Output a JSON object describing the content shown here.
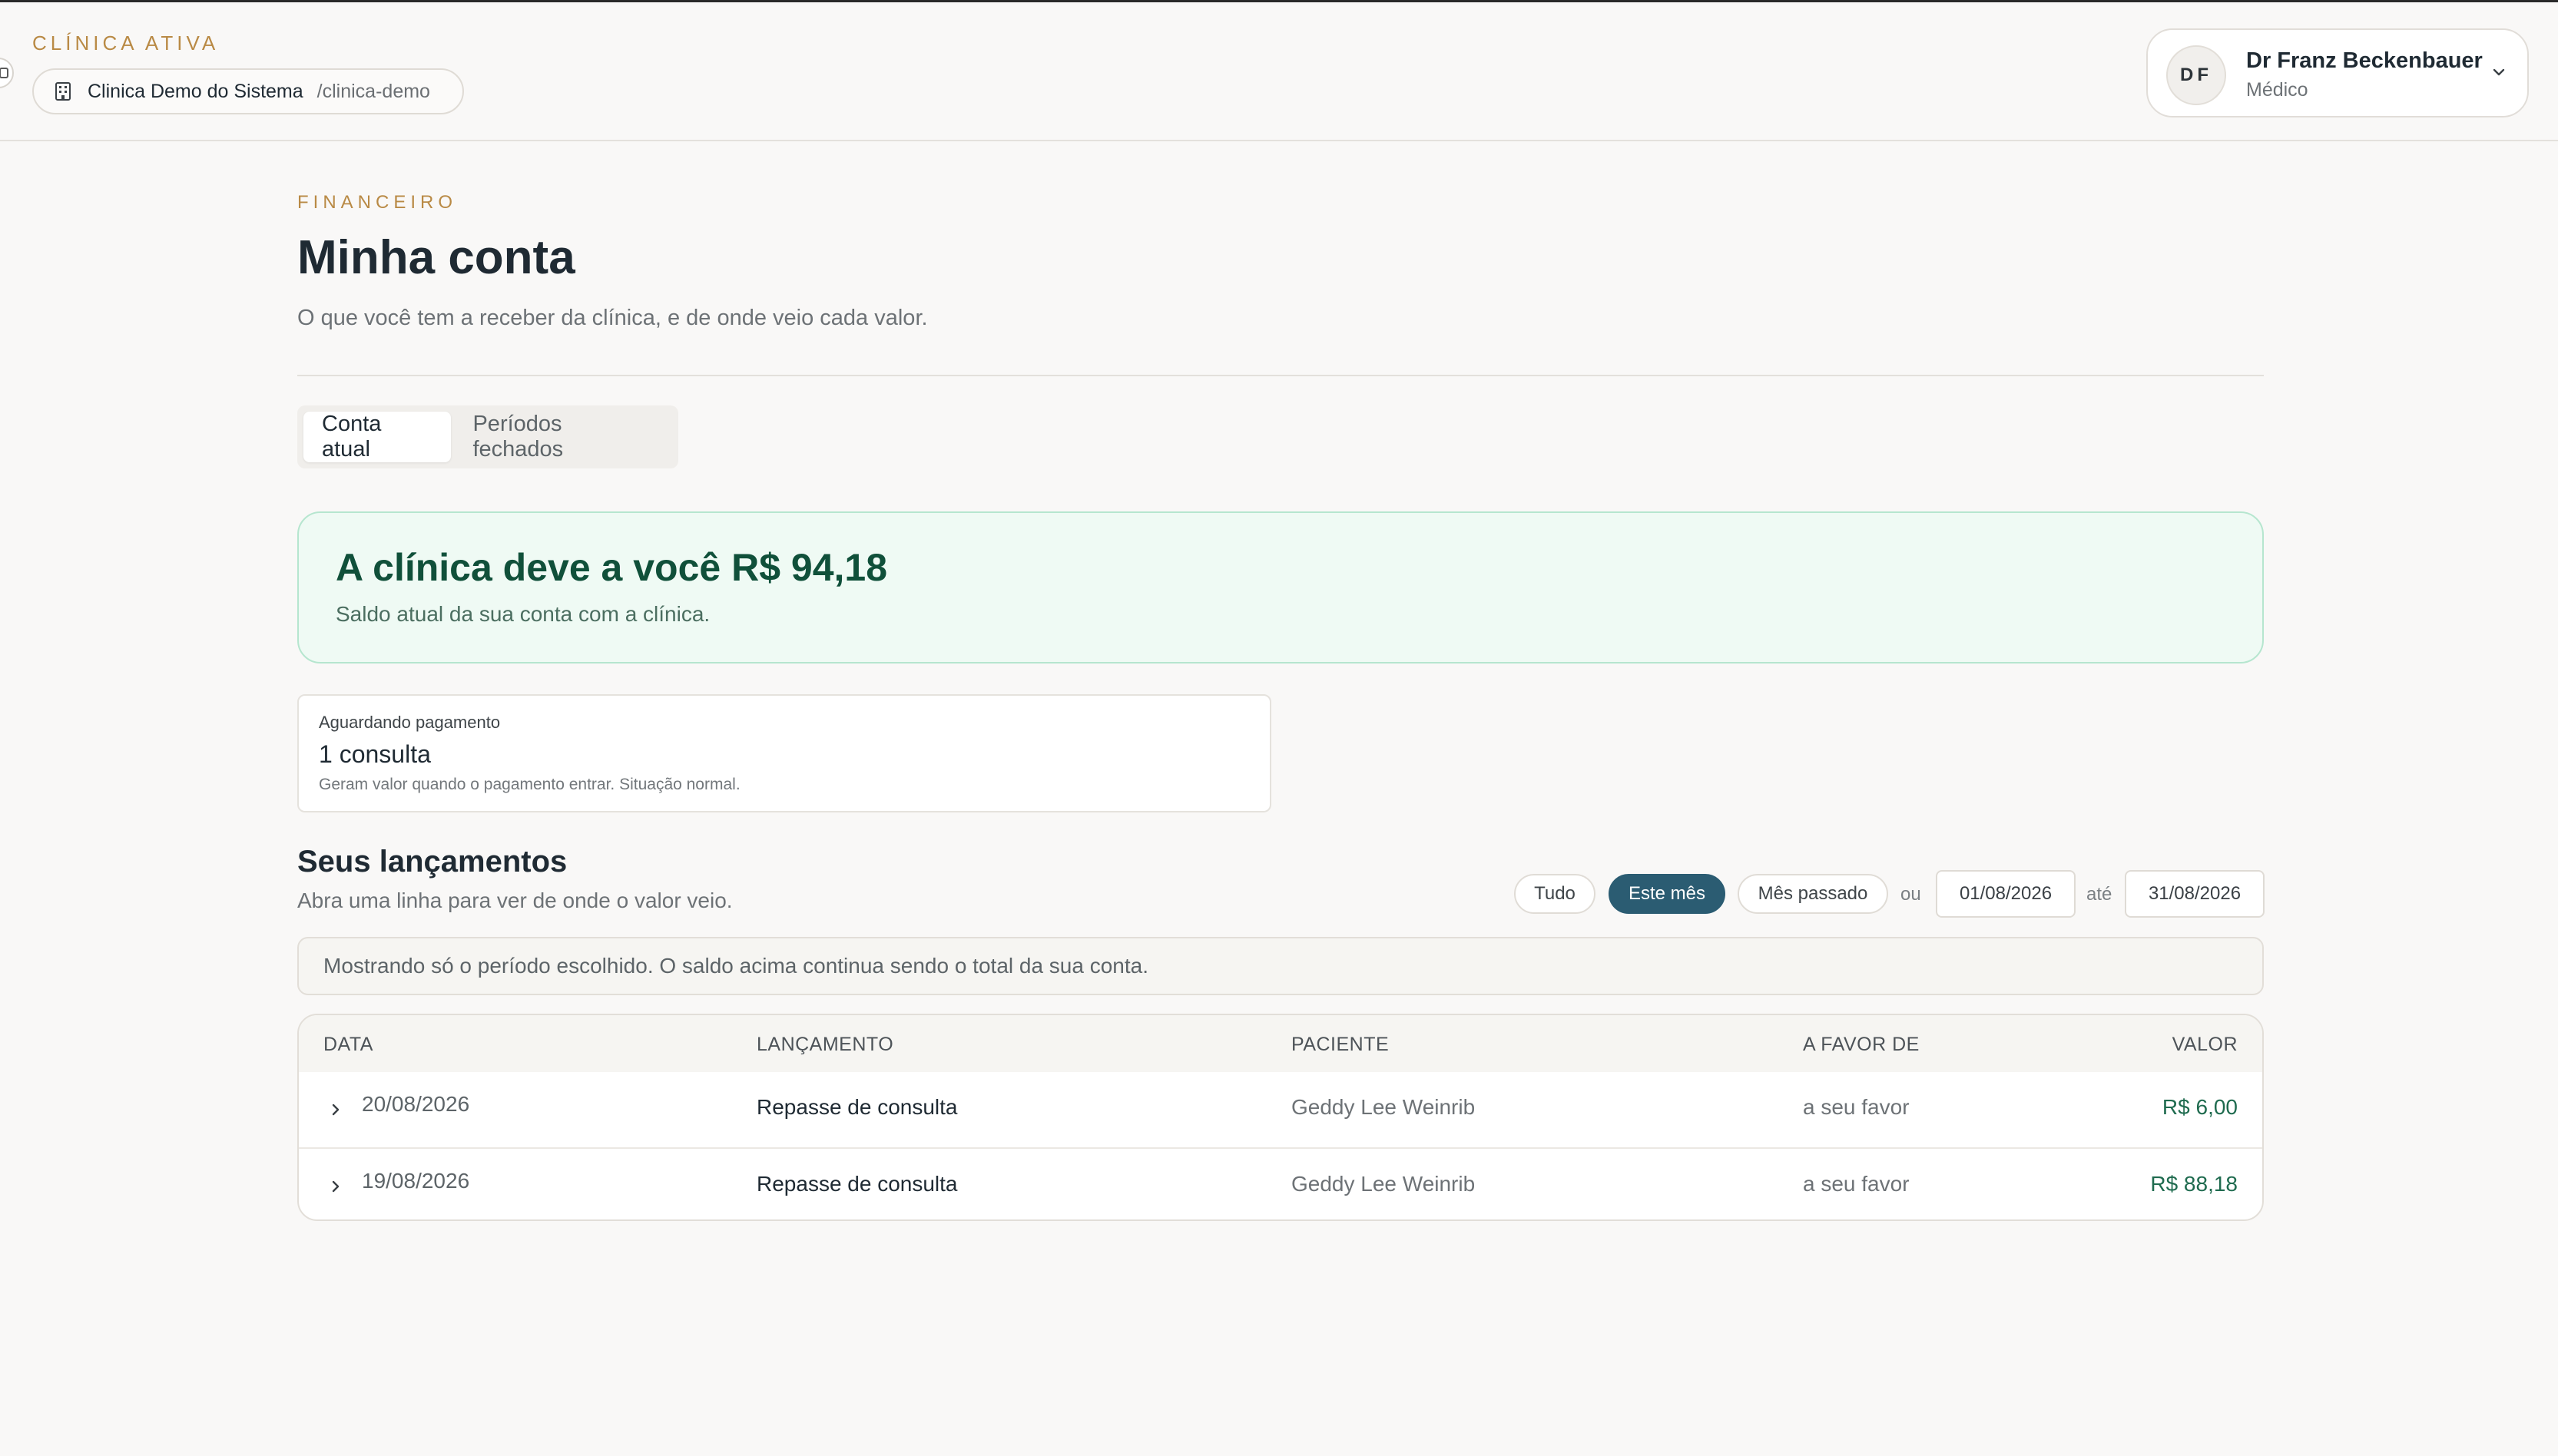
{
  "header": {
    "active_label": "CLÍNICA ATIVA",
    "clinic_name": "Clinica Demo do Sistema",
    "clinic_slug": "/clinica-demo",
    "user": {
      "initials": "DF",
      "name": "Dr Franz Beckenbauer",
      "role": "Médico"
    }
  },
  "page": {
    "section": "FINANCEIRO",
    "title": "Minha conta",
    "subtitle": "O que você tem a receber da clínica, e de onde veio cada valor."
  },
  "tabs": [
    {
      "label": "Conta atual",
      "active": true
    },
    {
      "label": "Períodos fechados",
      "active": false
    }
  ],
  "balance": {
    "title": "A clínica deve a você R$ 94,18",
    "subtitle": "Saldo atual da sua conta com a clínica."
  },
  "pending": {
    "label": "Aguardando pagamento",
    "value": "1 consulta",
    "note": "Geram valor quando o pagamento entrar. Situação normal."
  },
  "entries": {
    "title": "Seus lançamentos",
    "subtitle": "Abra uma linha para ver de onde o valor veio.",
    "filters": {
      "all": "Tudo",
      "this_month": "Este mês",
      "last_month": "Mês passado",
      "or": "ou",
      "until": "até",
      "date_from": "01/08/2026",
      "date_to": "31/08/2026",
      "active": "this_month"
    },
    "info": "Mostrando só o período escolhido. O saldo acima continua sendo o total da sua conta.",
    "columns": {
      "date": "DATA",
      "entry": "LANÇAMENTO",
      "patient": "PACIENTE",
      "favor": "A FAVOR DE",
      "value": "VALOR"
    },
    "rows": [
      {
        "date": "20/08/2026",
        "entry": "Repasse de consulta",
        "patient": "Geddy Lee Weinrib",
        "favor": "a seu favor",
        "value": "R$ 6,00"
      },
      {
        "date": "19/08/2026",
        "entry": "Repasse de consulta",
        "patient": "Geddy Lee Weinrib",
        "favor": "a seu favor",
        "value": "R$ 88,18"
      }
    ]
  },
  "colors": {
    "accent_gold": "#b98a45",
    "chip_active": "#2b5c72",
    "positive": "#1f6b4f",
    "balance_bg": "#effaf4"
  }
}
